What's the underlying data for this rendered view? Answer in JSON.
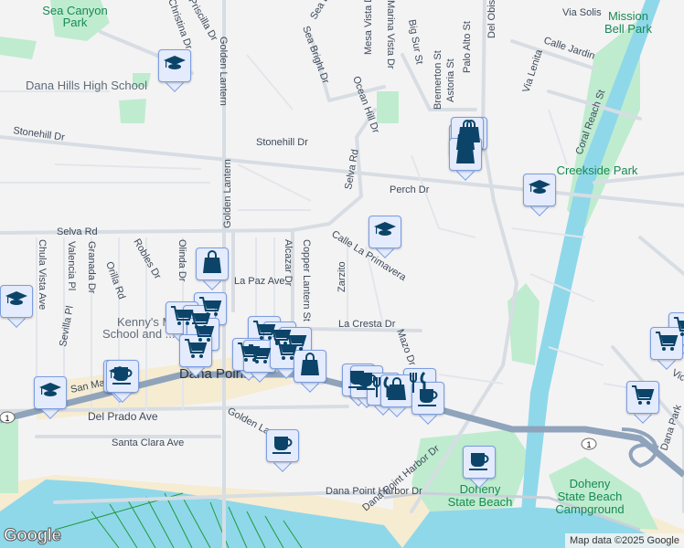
{
  "parks": [
    "Sea Canyon",
    "Park",
    "Mission",
    "Bell Park",
    "Creekside Park",
    "Doheny",
    "State Beach",
    "Doheny",
    "State Beach",
    "Campground"
  ],
  "pois": [
    "Dana Hills High School",
    "Kenny's Music",
    "School and ...",
    "Dana Point"
  ],
  "streets": [
    "Stonehill Dr",
    "Stonehill Dr",
    "Golden Lantern",
    "Golden Lantern",
    "Selva Rd",
    "Selva Rd",
    "Perch Dr",
    "Calle La Primavera",
    "La Paz Ave",
    "La Cresta Dr",
    "Mazo Dr",
    "Del Prado Ave",
    "Santa Clara Ave",
    "Golden Lantern",
    "Dana Point Harbor Dr",
    "San Marcos Pl",
    "Via Solis",
    "Calle Jardin",
    "Via Lenita",
    "Coral Reach St",
    "Del Obispo",
    "Palo Alto St",
    "Astoria St",
    "Bremerton St",
    "Big Sur St",
    "Marina Vista Dr",
    "Mesa Vista Dr",
    "Ocean Hill Dr",
    "Sea Bright Dr",
    "Christina Dr",
    "Priscilla Dr",
    "Alcazar Dr",
    "Copper Lantern St",
    "Olinda Dr",
    "Robles Dr",
    "Orilla Rd",
    "Granada Dr",
    "Valencia Pl",
    "Chula Vista Ave",
    "Zarzito",
    "Sevilla Pl",
    "Dana Park",
    "Victoria Blvd",
    "Dana Point Harbor Dr",
    "Sea Lion"
  ],
  "highway_shield": "1",
  "marker_types": [
    "school-icon",
    "shopping-bag-icon",
    "shopping-cart-icon",
    "coffee-icon",
    "restaurant-icon"
  ],
  "footer": {
    "credit": "Map data ©2025 Google",
    "logo": "Google"
  },
  "colors": {
    "land": "#f4f3f4",
    "water": "#8fd8ea",
    "park": "#bfeccf",
    "highway": "#8fa3bb",
    "road": "#d7dde3",
    "marker_fill": "#e3ebfc",
    "marker_icon": "#0b4468"
  }
}
